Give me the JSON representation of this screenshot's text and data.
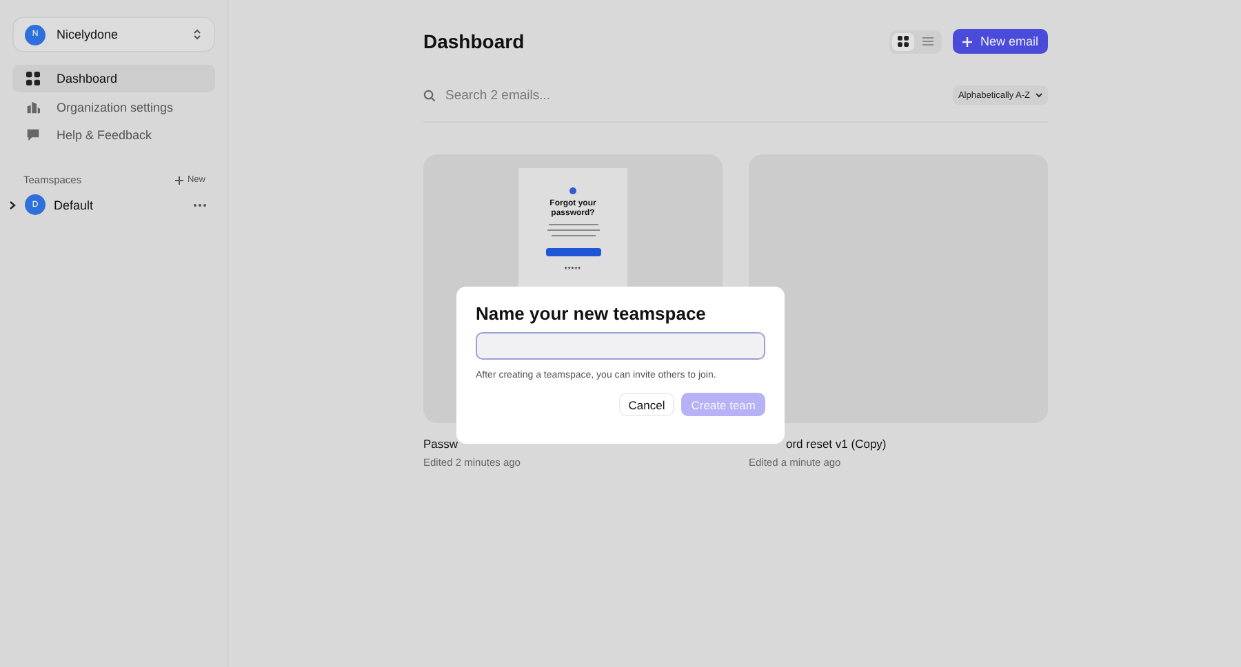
{
  "sidebar": {
    "workspace": {
      "initial": "N",
      "name": "Nicelydone"
    },
    "nav": [
      {
        "label": "Dashboard",
        "selected": true
      },
      {
        "label": "Organization settings",
        "selected": false
      },
      {
        "label": "Help & Feedback",
        "selected": false
      }
    ],
    "teamspaces": {
      "title": "Teamspaces",
      "new_label": "New",
      "items": [
        {
          "initial": "D",
          "name": "Default",
          "expanded": false
        }
      ]
    }
  },
  "main": {
    "title": "Dashboard",
    "view_toggle": [
      {
        "selected": true
      },
      {
        "selected": false
      }
    ],
    "new_button": "New email",
    "search": {
      "placeholder": "Search 2 emails..."
    },
    "sort": "Alphabetically A-Z",
    "emails": [
      {
        "title": "Passw",
        "edited": "Edited 2 minutes ago",
        "preview": {
          "heading": "Forgot your password?",
          "footer": "*****"
        }
      },
      {
        "title": "ord reset v1 (Copy)",
        "edited": "Edited a minute ago"
      }
    ]
  },
  "dialog": {
    "title": "Name your new teamspace",
    "hint": "After creating a teamspace, you can invite others to join.",
    "buttons": [
      {
        "label": "Cancel",
        "kind": "secondary",
        "disabled": false
      },
      {
        "label": "Create team",
        "kind": "primary",
        "disabled": true
      }
    ]
  }
}
